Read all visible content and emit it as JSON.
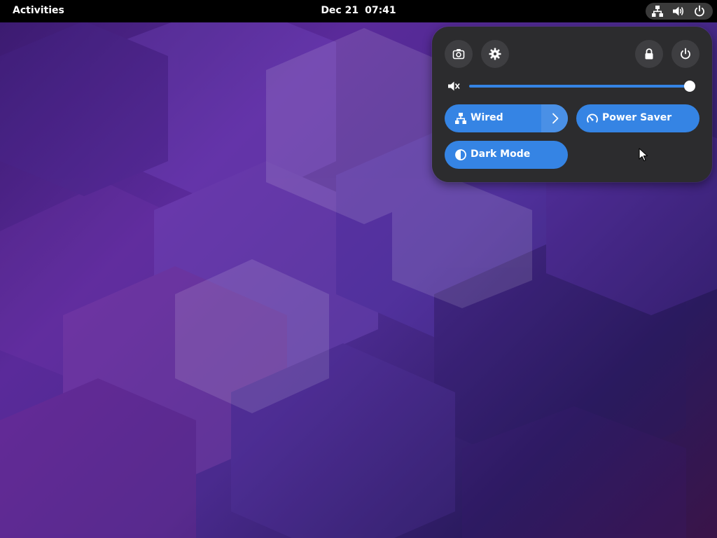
{
  "topbar": {
    "activities_label": "Activities",
    "date": "Dec 21",
    "time": "07:41",
    "status_icons": [
      "network-wired-icon",
      "speaker-volume-icon",
      "power-icon"
    ]
  },
  "quick_settings": {
    "top_buttons": [
      "screenshot-icon",
      "settings-gear-icon",
      "lock-icon",
      "power-icon"
    ],
    "volume": {
      "icon": "speaker-muted-icon",
      "level": 1.0
    },
    "toggles": {
      "wired": {
        "label": "Wired",
        "active": true,
        "icon": "network-wired-icon"
      },
      "power_saver": {
        "label": "Power Saver",
        "active": true,
        "icon": "power-profile-icon"
      },
      "dark_mode": {
        "label": "Dark Mode",
        "active": true,
        "icon": "dark-mode-icon"
      }
    }
  },
  "colors": {
    "accent": "#3584e4",
    "panel_bg": "#2c2c2e",
    "topbar_bg": "#000000",
    "button_bg": "#3e3e41"
  }
}
